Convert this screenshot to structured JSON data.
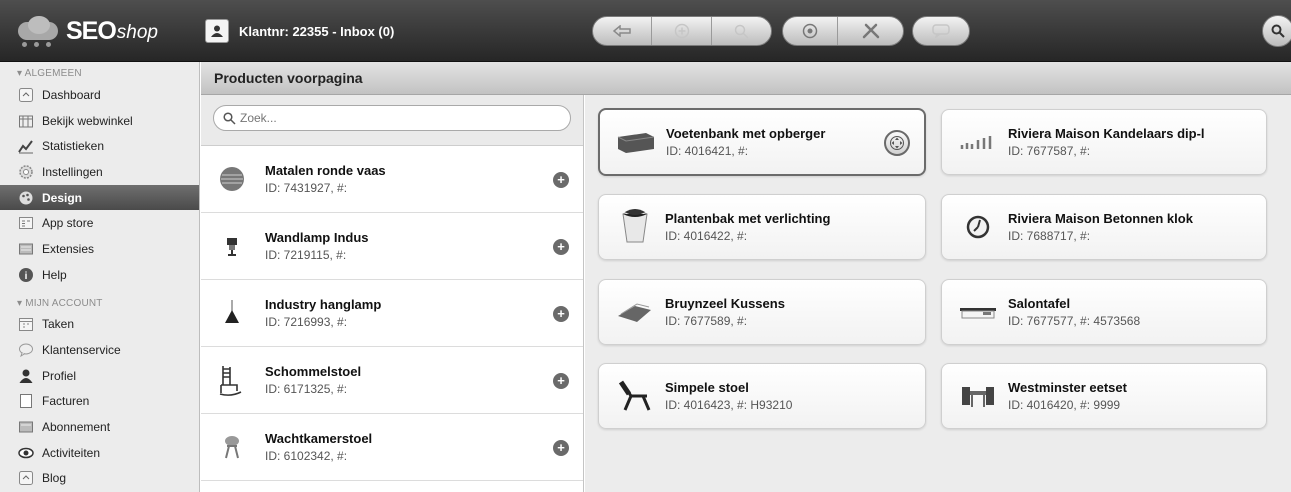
{
  "app": {
    "logo_text": "SEO",
    "logo_sub": "shop",
    "customer_text": "Klantnr: 22355 - Inbox (0)"
  },
  "toolbar": {
    "icons": [
      "back-arrow-icon",
      "add-icon",
      "search-icon",
      "info-icon",
      "tools-icon",
      "chat-icon",
      "search-icon"
    ]
  },
  "sidebar": {
    "section1": "▾ ALGEMEEN",
    "items1": [
      {
        "label": "Dashboard",
        "icon": "dashboard-icon"
      },
      {
        "label": "Bekijk webwinkel",
        "icon": "store-icon"
      },
      {
        "label": "Statistieken",
        "icon": "chart-icon"
      },
      {
        "label": "Instellingen",
        "icon": "gear-icon"
      },
      {
        "label": "Design",
        "icon": "palette-icon"
      },
      {
        "label": "App store",
        "icon": "app-icon"
      },
      {
        "label": "Extensies",
        "icon": "extension-icon"
      },
      {
        "label": "Help",
        "icon": "help-icon"
      }
    ],
    "section2": "▾ MIJN ACCOUNT",
    "items2": [
      {
        "label": "Taken",
        "icon": "calendar-icon"
      },
      {
        "label": "Klantenservice",
        "icon": "chat-icon"
      },
      {
        "label": "Profiel",
        "icon": "user-icon"
      },
      {
        "label": "Facturen",
        "icon": "invoice-icon"
      },
      {
        "label": "Abonnement",
        "icon": "subscription-icon"
      },
      {
        "label": "Activiteiten",
        "icon": "eye-icon"
      },
      {
        "label": "Blog",
        "icon": "blog-icon"
      }
    ]
  },
  "main": {
    "title": "Producten voorpagina",
    "search_placeholder": "Zoek...",
    "list": [
      {
        "name": "Matalen ronde vaas",
        "id": "ID: 7431927, #:"
      },
      {
        "name": "Wandlamp Indus",
        "id": "ID: 7219115, #:"
      },
      {
        "name": "Industry hanglamp",
        "id": "ID: 7216993, #:"
      },
      {
        "name": "Schommelstoel",
        "id": "ID: 6171325, #:"
      },
      {
        "name": "Wachtkamerstoel",
        "id": "ID: 6102342, #:"
      }
    ],
    "grid": [
      {
        "name": "Voetenbank met opberger",
        "id": "ID: 4016421, #:"
      },
      {
        "name": "Riviera Maison Kandelaars dip-l",
        "id": "ID: 7677587, #:"
      },
      {
        "name": "Plantenbak met verlichting",
        "id": "ID: 4016422, #:"
      },
      {
        "name": "Riviera Maison Betonnen klok",
        "id": "ID: 7688717, #:"
      },
      {
        "name": "Bruynzeel Kussens",
        "id": "ID: 7677589, #:"
      },
      {
        "name": "Salontafel",
        "id": "ID: 7677577, #: 4573568"
      },
      {
        "name": "Simpele stoel",
        "id": "ID: 4016423, #: H93210"
      },
      {
        "name": "Westminster eetset",
        "id": "ID: 4016420, #: 9999"
      }
    ]
  }
}
